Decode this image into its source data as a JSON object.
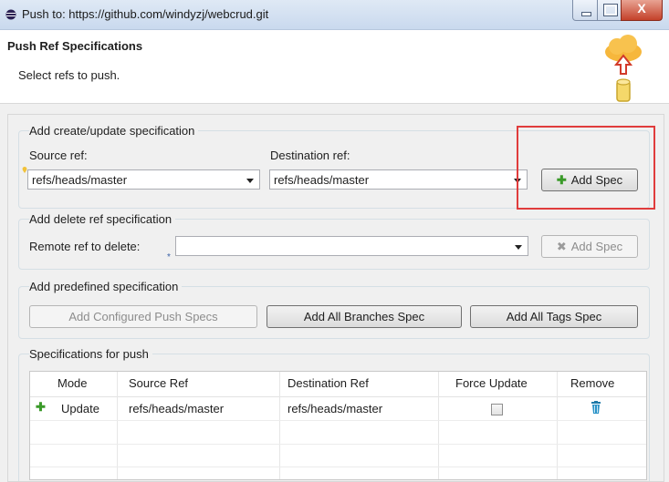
{
  "window": {
    "title": "Push to: https://github.com/windyzj/webcrud.git",
    "close_glyph": "X"
  },
  "header": {
    "title": "Push Ref Specifications",
    "subtitle": "Select refs to push.",
    "icon": "cloud-push-icon"
  },
  "create_update": {
    "group_label": "Add create/update specification",
    "source_label": "Source ref:",
    "source_value": "refs/heads/master",
    "dest_label": "Destination ref:",
    "dest_value": "refs/heads/master",
    "add_button": "Add Spec"
  },
  "delete_ref": {
    "group_label": "Add delete ref specification",
    "remote_label": "Remote ref to delete:",
    "remote_value": "",
    "add_button": "Add Spec"
  },
  "predefined": {
    "group_label": "Add predefined specification",
    "configured_button": "Add Configured Push Specs",
    "branches_button": "Add All Branches Spec",
    "tags_button": "Add All Tags Spec"
  },
  "specs": {
    "group_label": "Specifications for push",
    "columns": [
      "Mode",
      "Source Ref",
      "Destination Ref",
      "Force Update",
      "Remove"
    ],
    "rows": [
      {
        "mode": "Update",
        "source": "refs/heads/master",
        "destination": "refs/heads/master",
        "force_update": false
      }
    ]
  },
  "colors": {
    "highlight": "#e03c3c",
    "accent_green": "#3a9a29"
  }
}
